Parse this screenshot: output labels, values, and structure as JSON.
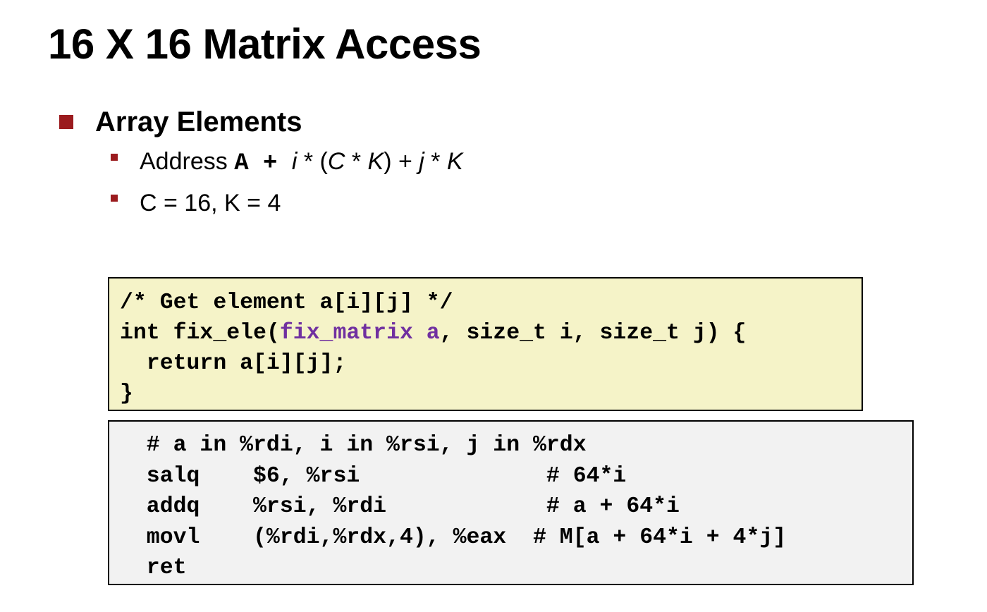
{
  "title": "16 X 16 Matrix Access",
  "bullets": {
    "main": "Array Elements",
    "sub1": {
      "prefix": "Address ",
      "base": "A",
      "plus1": " + ",
      "i": "i",
      "star1": " * (",
      "C": "C",
      "star2": " * ",
      "K1": "K",
      "close": ") + ",
      "j": "j",
      "star3": " * ",
      "K2": "K"
    },
    "sub2": "C = 16, K = 4"
  },
  "c_code": {
    "line1": "/* Get element a[i][j] */",
    "line2_a": "int fix_ele(",
    "line2_b": "fix_matrix a",
    "line2_c": ", size_t i, size_t j) {",
    "line3": "  return a[i][j];",
    "line4": "}"
  },
  "asm_code": {
    "line1": "  # a in %rdi, i in %rsi, j in %rdx",
    "line2": "  salq    $6, %rsi              # 64*i",
    "line3": "  addq    %rsi, %rdi            # a + 64*i",
    "line4": "  movl    (%rdi,%rdx,4), %eax  # M[a + 64*i + 4*j]",
    "line5": "  ret"
  },
  "colors": {
    "bullet_red": "#9b1b1e",
    "c_code_bg": "#f5f3c8",
    "asm_code_bg": "#f2f2f2",
    "highlight_purple": "#7030a0"
  }
}
